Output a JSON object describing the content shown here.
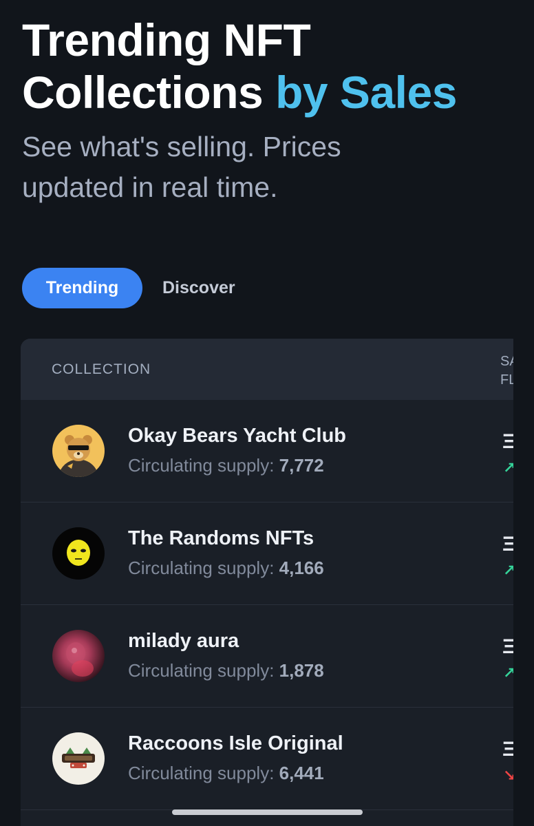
{
  "hero": {
    "title_main": "Trending NFT Collections",
    "title_accent": "by Sales",
    "subtitle": "See what's selling. Prices updated in real time."
  },
  "tabs": [
    {
      "label": "Trending",
      "active": true
    },
    {
      "label": "Discover",
      "active": false
    }
  ],
  "table": {
    "headers": {
      "collection": "COLLECTION",
      "sales_floor_partial": "SA\nFL"
    },
    "supply_label": "Circulating supply: ",
    "rows": [
      {
        "name": "Okay Bears Yacht Club",
        "supply": "7,772",
        "eth_glyph": "Ξ",
        "trend_glyph": "↗",
        "trend": "up",
        "avatar_icon": "bear-avatar-icon"
      },
      {
        "name": "The Randoms NFTs",
        "supply": "4,166",
        "eth_glyph": "Ξ",
        "trend_glyph": "↗",
        "trend": "up",
        "avatar_icon": "yellow-face-avatar-icon"
      },
      {
        "name": "milady aura",
        "supply": "1,878",
        "eth_glyph": "Ξ",
        "trend_glyph": "↗",
        "trend": "up",
        "avatar_icon": "blurred-pink-avatar-icon"
      },
      {
        "name": "Raccoons Isle Original",
        "supply": "6,441",
        "eth_glyph": "Ξ",
        "trend_glyph": "↘",
        "trend": "down",
        "avatar_icon": "raccoon-logo-avatar-icon"
      }
    ]
  },
  "colors": {
    "background": "#11151b",
    "accent": "#4fc1ee",
    "tab_active": "#3b83f2",
    "trend_up": "#35d399",
    "trend_down": "#ef4444"
  }
}
